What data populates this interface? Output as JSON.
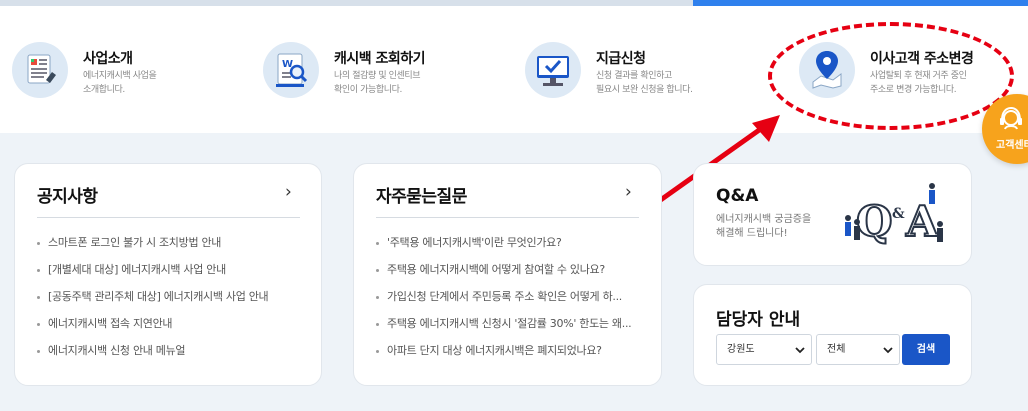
{
  "services": [
    {
      "title": "사업소개",
      "desc": [
        "에너지캐시백 사업을",
        "소개합니다."
      ],
      "icon": "document-icon"
    },
    {
      "title": "캐시백 조회하기",
      "desc": [
        "나의 절감량 및 인센티브",
        "확인이 가능합니다."
      ],
      "icon": "word-search-icon"
    },
    {
      "title": "지급신청",
      "desc": [
        "신청 결과를 확인하고",
        "필요시 보완 신청을 합니다."
      ],
      "icon": "monitor-check-icon"
    },
    {
      "title": "이사고객 주소변경",
      "desc": [
        "사업탈퇴 후 현재 거주 중인",
        "주소로 변경 가능합니다."
      ],
      "icon": "map-pin-icon"
    }
  ],
  "floating": {
    "customer_center": "고객센터"
  },
  "notice": {
    "title": "공지사항",
    "items": [
      "스마트폰 로그인 불가 시 조치방법 안내",
      "[개별세대 대상] 에너지캐시백 사업 안내",
      "[공동주택 관리주체 대상] 에너지캐시백 사업 안내",
      "에너지캐시백 접속 지연안내",
      "에너지캐시백 신청 안내 메뉴얼"
    ]
  },
  "faq": {
    "title": "자주묻는질문",
    "items": [
      "'주택용 에너지캐시백'이란 무엇인가요?",
      "주택용 에너지캐시백에 어떻게 참여할 수 있나요?",
      "가입신청 단계에서 주민등록 주소 확인은 어떻게 하...",
      "주택용 에너지캐시백 신청시 '절감률 30%' 한도는 왜...",
      "아파트 단지 대상 에너지캐시백은 폐지되었나요?"
    ]
  },
  "qa": {
    "title": "Q&A",
    "desc": [
      "에너지캐시백 궁금증을",
      "해결해 드립니다!"
    ]
  },
  "staff": {
    "title": "담당자 안내",
    "region": "강원도",
    "scope": "전체",
    "search_label": "검색"
  },
  "colors": {
    "accent": "#1a56c7",
    "highlight": "#e60012",
    "floating": "#f7a31c"
  }
}
